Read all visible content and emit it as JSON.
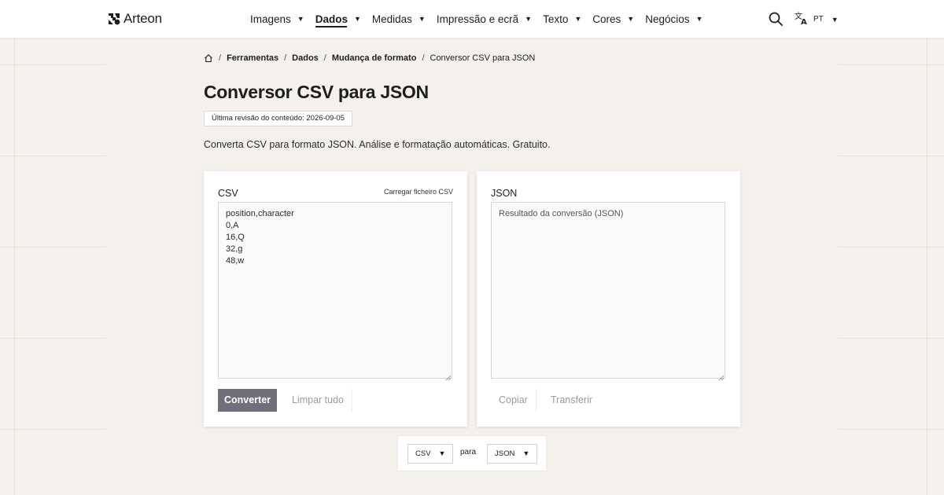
{
  "brand": {
    "name": "Arteon"
  },
  "nav": {
    "items": [
      {
        "label": "Imagens",
        "active": false
      },
      {
        "label": "Dados",
        "active": true
      },
      {
        "label": "Medidas",
        "active": false
      },
      {
        "label": "Impressão e ecrã",
        "active": false
      },
      {
        "label": "Texto",
        "active": false
      },
      {
        "label": "Cores",
        "active": false
      },
      {
        "label": "Negócios",
        "active": false
      }
    ],
    "caret": "▼",
    "search_icon": "search-icon",
    "language": {
      "code": "PT",
      "icon": "translate-icon"
    }
  },
  "breadcrumb": {
    "home_icon": "home-icon",
    "separator": "/",
    "items": [
      "Ferramentas",
      "Dados",
      "Mudança de formato"
    ],
    "current": "Conversor CSV para JSON"
  },
  "page": {
    "title": "Conversor CSV para JSON",
    "revision": "Última revisão do conteúdo: 2026-09-05",
    "description": "Converta CSV para formato JSON. Análise e formatação automáticas. Gratuito."
  },
  "input_panel": {
    "label": "CSV",
    "upload_label": "Carregar ficheiro CSV",
    "value": "position,character\n0,A\n16,Q\n32,g\n48,w",
    "convert_label": "Converter",
    "clear_label": "Limpar tudo"
  },
  "output_panel": {
    "label": "JSON",
    "placeholder": "Resultado da conversão (JSON)",
    "copy_label": "Copiar",
    "download_label": "Transferir"
  },
  "format_bar": {
    "from": "CSV",
    "connector": "para",
    "to": "JSON"
  },
  "colors": {
    "accent_button": "#6f707a",
    "background": "#f5f2ee",
    "panel": "#ffffff",
    "text": "#1d1d1b"
  }
}
